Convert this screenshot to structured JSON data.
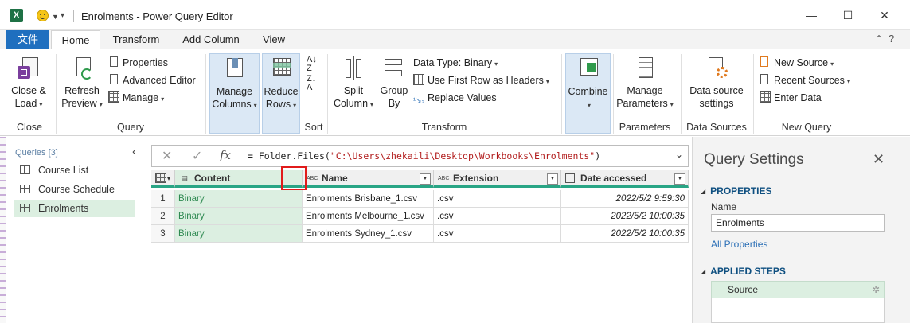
{
  "window": {
    "title": "Enrolments - Power Query Editor",
    "excel_logo": "X",
    "min_glyph": "—",
    "max_glyph": "☐",
    "close_glyph": "✕"
  },
  "tabs": {
    "file": "文件",
    "home": "Home",
    "transform": "Transform",
    "add_column": "Add Column",
    "view": "View"
  },
  "ribbon": {
    "close_load": {
      "line1": "Close &",
      "line2": "Load"
    },
    "refresh_preview": {
      "line1": "Refresh",
      "line2": "Preview"
    },
    "properties": "Properties",
    "advanced_editor": "Advanced Editor",
    "manage": "Manage",
    "manage_columns": {
      "line1": "Manage",
      "line2": "Columns"
    },
    "reduce_rows": {
      "line1": "Reduce",
      "line2": "Rows"
    },
    "split_column": {
      "line1": "Split",
      "line2": "Column"
    },
    "group_by": {
      "line1": "Group",
      "line2": "By"
    },
    "data_type": "Data Type: Binary",
    "use_first_row": "Use First Row as Headers",
    "replace_values": "Replace Values",
    "combine": "Combine",
    "manage_parameters": {
      "line1": "Manage",
      "line2": "Parameters"
    },
    "data_source_settings": {
      "line1": "Data source",
      "line2": "settings"
    },
    "new_source": "New Source",
    "recent_sources": "Recent Sources",
    "enter_data": "Enter Data",
    "group_labels": {
      "close": "Close",
      "query": "Query",
      "sort": "Sort",
      "transform": "Transform",
      "parameters": "Parameters",
      "data_sources": "Data Sources",
      "new_query": "New Query"
    }
  },
  "queries": {
    "header": "Queries [3]",
    "items": [
      {
        "label": "Course List"
      },
      {
        "label": "Course Schedule"
      },
      {
        "label": "Enrolments"
      }
    ]
  },
  "formula": {
    "prefix": "= Folder.Files(",
    "path": "\"C:\\Users\\zhekaili\\Desktop\\Workbooks\\Enrolments\"",
    "suffix": ")"
  },
  "table": {
    "columns": [
      {
        "name": "Content",
        "type_icon": "▤"
      },
      {
        "name": "Name",
        "type_icon": "ABC"
      },
      {
        "name": "Extension",
        "type_icon": "ABC"
      },
      {
        "name": "Date accessed",
        "type_icon": "📅"
      }
    ],
    "rows": [
      {
        "num": "1",
        "content": "Binary",
        "name": "Enrolments Brisbane_1.csv",
        "extension": ".csv",
        "date": "2022/5/2 9:59:30"
      },
      {
        "num": "2",
        "content": "Binary",
        "name": "Enrolments Melbourne_1.csv",
        "extension": ".csv",
        "date": "2022/5/2 10:00:35"
      },
      {
        "num": "3",
        "content": "Binary",
        "name": "Enrolments Sydney_1.csv",
        "extension": ".csv",
        "date": "2022/5/2 10:00:35"
      }
    ]
  },
  "settings": {
    "title": "Query Settings",
    "properties_header": "PROPERTIES",
    "name_label": "Name",
    "name_value": "Enrolments",
    "all_properties": "All Properties",
    "applied_steps_header": "APPLIED STEPS",
    "steps": [
      {
        "label": "Source"
      }
    ]
  },
  "colors": {
    "accent": "#1f6fbf",
    "selected_green": "#dcefe1",
    "header_underline": "#29a585",
    "highlight_red": "#e11b1b"
  }
}
